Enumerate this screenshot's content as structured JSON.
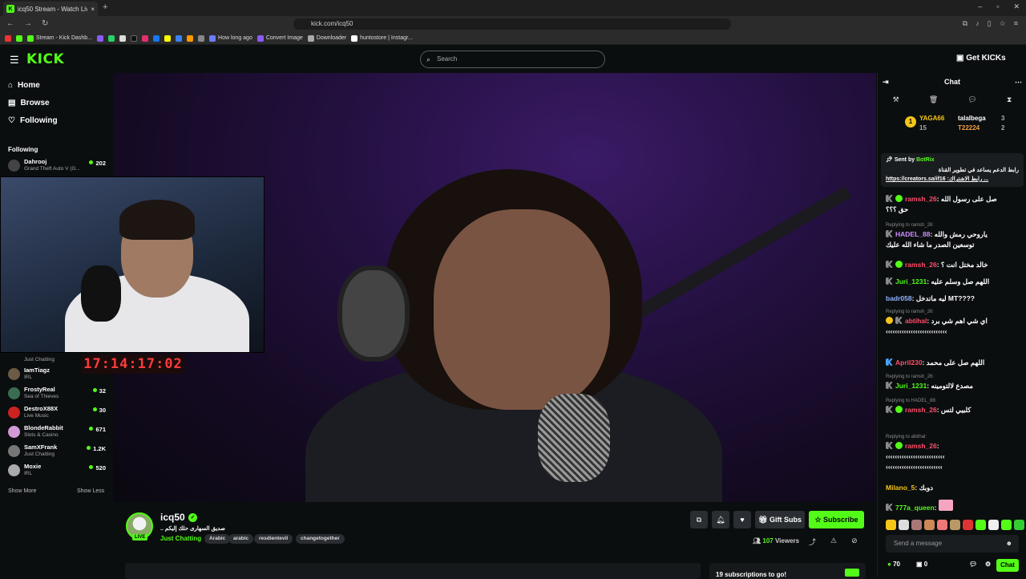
{
  "browser": {
    "tab_title": "icq50 Stream - Watch Live on Ki...",
    "tab_close": "×",
    "new_tab": "+",
    "url": "kick.com/icq50",
    "bookmarks": [
      "Stream - Kick Dashb...",
      "How long ago",
      "Convert Image",
      "Downloader",
      "huntostore | Instagr..."
    ]
  },
  "header": {
    "logo": "KICK",
    "search_placeholder": "Search",
    "get_kicks": "Get KICKs"
  },
  "sidebar": {
    "nav": [
      {
        "label": "Home",
        "icon": "home-icon"
      },
      {
        "label": "Browse",
        "icon": "browse-icon"
      },
      {
        "label": "Following",
        "icon": "heart-icon"
      }
    ],
    "following_heading": "Following",
    "channels_top": [
      {
        "name": "Dahrooj",
        "game": "Grand Theft Auto V (G...",
        "viewers": "202",
        "color": "#444"
      }
    ],
    "channels_bottom": [
      {
        "name": "IamTiagz",
        "game": "IRL",
        "viewers": "",
        "color": "#6b5b45"
      },
      {
        "name": "FrostyReal",
        "game": "Sea of Thieves",
        "viewers": "32",
        "color": "#3a6d50"
      },
      {
        "name": "DestroX88X",
        "game": "Live Music",
        "viewers": "30",
        "color": "#c22"
      },
      {
        "name": "BlondeRabbit",
        "game": "Slots & Casino",
        "viewers": "671",
        "color": "#d19ad6"
      },
      {
        "name": "SamXFrank",
        "game": "Just Chatting",
        "viewers": "1.2K",
        "color": "#777"
      },
      {
        "name": "Moxie",
        "game": "IRL",
        "viewers": "520",
        "color": "#aaa"
      }
    ],
    "partial_game": "Just Chatting",
    "show_more": "Show More",
    "show_less": "Show Less"
  },
  "video": {
    "timer": "17:14:17:02"
  },
  "stream": {
    "channel": "icq50",
    "live": "LIVE",
    "title": ".. صديق السهارى حلك إليكم",
    "category": "Just Chatting",
    "tags": [
      "Arabic",
      "arabic",
      "resdientevil",
      "changetogether"
    ],
    "gift_subs": "Gift Subs",
    "subscribe": "Subscribe",
    "viewers_count": "107",
    "viewers_label": "Viewers",
    "sub_goal": "19 subscriptions to go!"
  },
  "chat": {
    "title": "Chat",
    "leaderboard": [
      {
        "name": "YAGA66",
        "count": "15"
      },
      {
        "name": "talalbega",
        "count": "3"
      },
      {
        "name": "T22224",
        "count": "2"
      }
    ],
    "pinned": {
      "sent_by": "Sent by",
      "sender": "BotRix",
      "line1": "رابط الدعم يساعد في تطوير القناة",
      "line2": "https://creators.sa/if16 :رابط الاشتراك ..."
    },
    "messages": [
      {
        "user": "ramsh_26",
        "color": "#ff4d6a",
        "text": "صل على رسول الله",
        "text2": "حق ؟؟؟",
        "reply": ""
      },
      {
        "user": "HADEL_88",
        "color": "#d18bff",
        "text": "ياروحي رمش والله",
        "text2": "توسعين الصدر ما شاء الله عليك",
        "reply": "Replying to ramsh_26:"
      },
      {
        "user": "ramsh_26",
        "color": "#ff4d6a",
        "text": "خالد مختل انت ؟",
        "text2": "",
        "reply": ""
      },
      {
        "user": "Juri_1231",
        "color": "#53fc18",
        "text": "اللهم صل وسلم عليه",
        "text2": "",
        "reply": ""
      },
      {
        "user": "badr058",
        "color": "#8fb4ff",
        "text": "ليه ماتدخل MT????",
        "text2": "",
        "reply": ""
      },
      {
        "user": "abtihal",
        "color": "#ff4d6a",
        "text": "اي شي اهم شي برد",
        "text2": "‹‹‹‹‹‹‹‹‹‹‹‹‹‹‹‹‹‹‹‹‹‹‹‹‹‹‹",
        "reply": "Replying to ramsh_26:"
      },
      {
        "user": "April230",
        "color": "#ff4d6a",
        "text": "اللهم صل على محمد",
        "text2": "",
        "reply": ""
      },
      {
        "user": "Juri_1231",
        "color": "#53fc18",
        "text": "مصدع لالتومينه",
        "text2": "",
        "reply": "Replying to ramsh_26:"
      },
      {
        "user": "ramsh_26",
        "color": "#ff4d6a",
        "text": "كلبيي لتس",
        "text2": "",
        "reply": "Replying to HADEL_88:"
      },
      {
        "user": "ramsh_26",
        "color": "#ff4d6a",
        "text": "‹‹‹‹‹‹‹‹‹‹‹‹‹‹‹‹‹‹‹‹‹‹‹‹‹‹",
        "text2": "‹‹‹‹‹‹‹‹‹‹‹‹‹‹‹‹‹‹‹‹‹‹‹‹‹",
        "reply": "Replying to abtihal:"
      },
      {
        "user": "Milano_5",
        "color": "#f5c518",
        "text": "دوبك",
        "text2": "",
        "reply": ""
      },
      {
        "user": "777a_queen",
        "color": "#53fc18",
        "text": "",
        "text2": "",
        "reply": ""
      }
    ],
    "input_placeholder": "Send a message",
    "points": "70",
    "gifts": "0",
    "chat_button": "Chat"
  }
}
